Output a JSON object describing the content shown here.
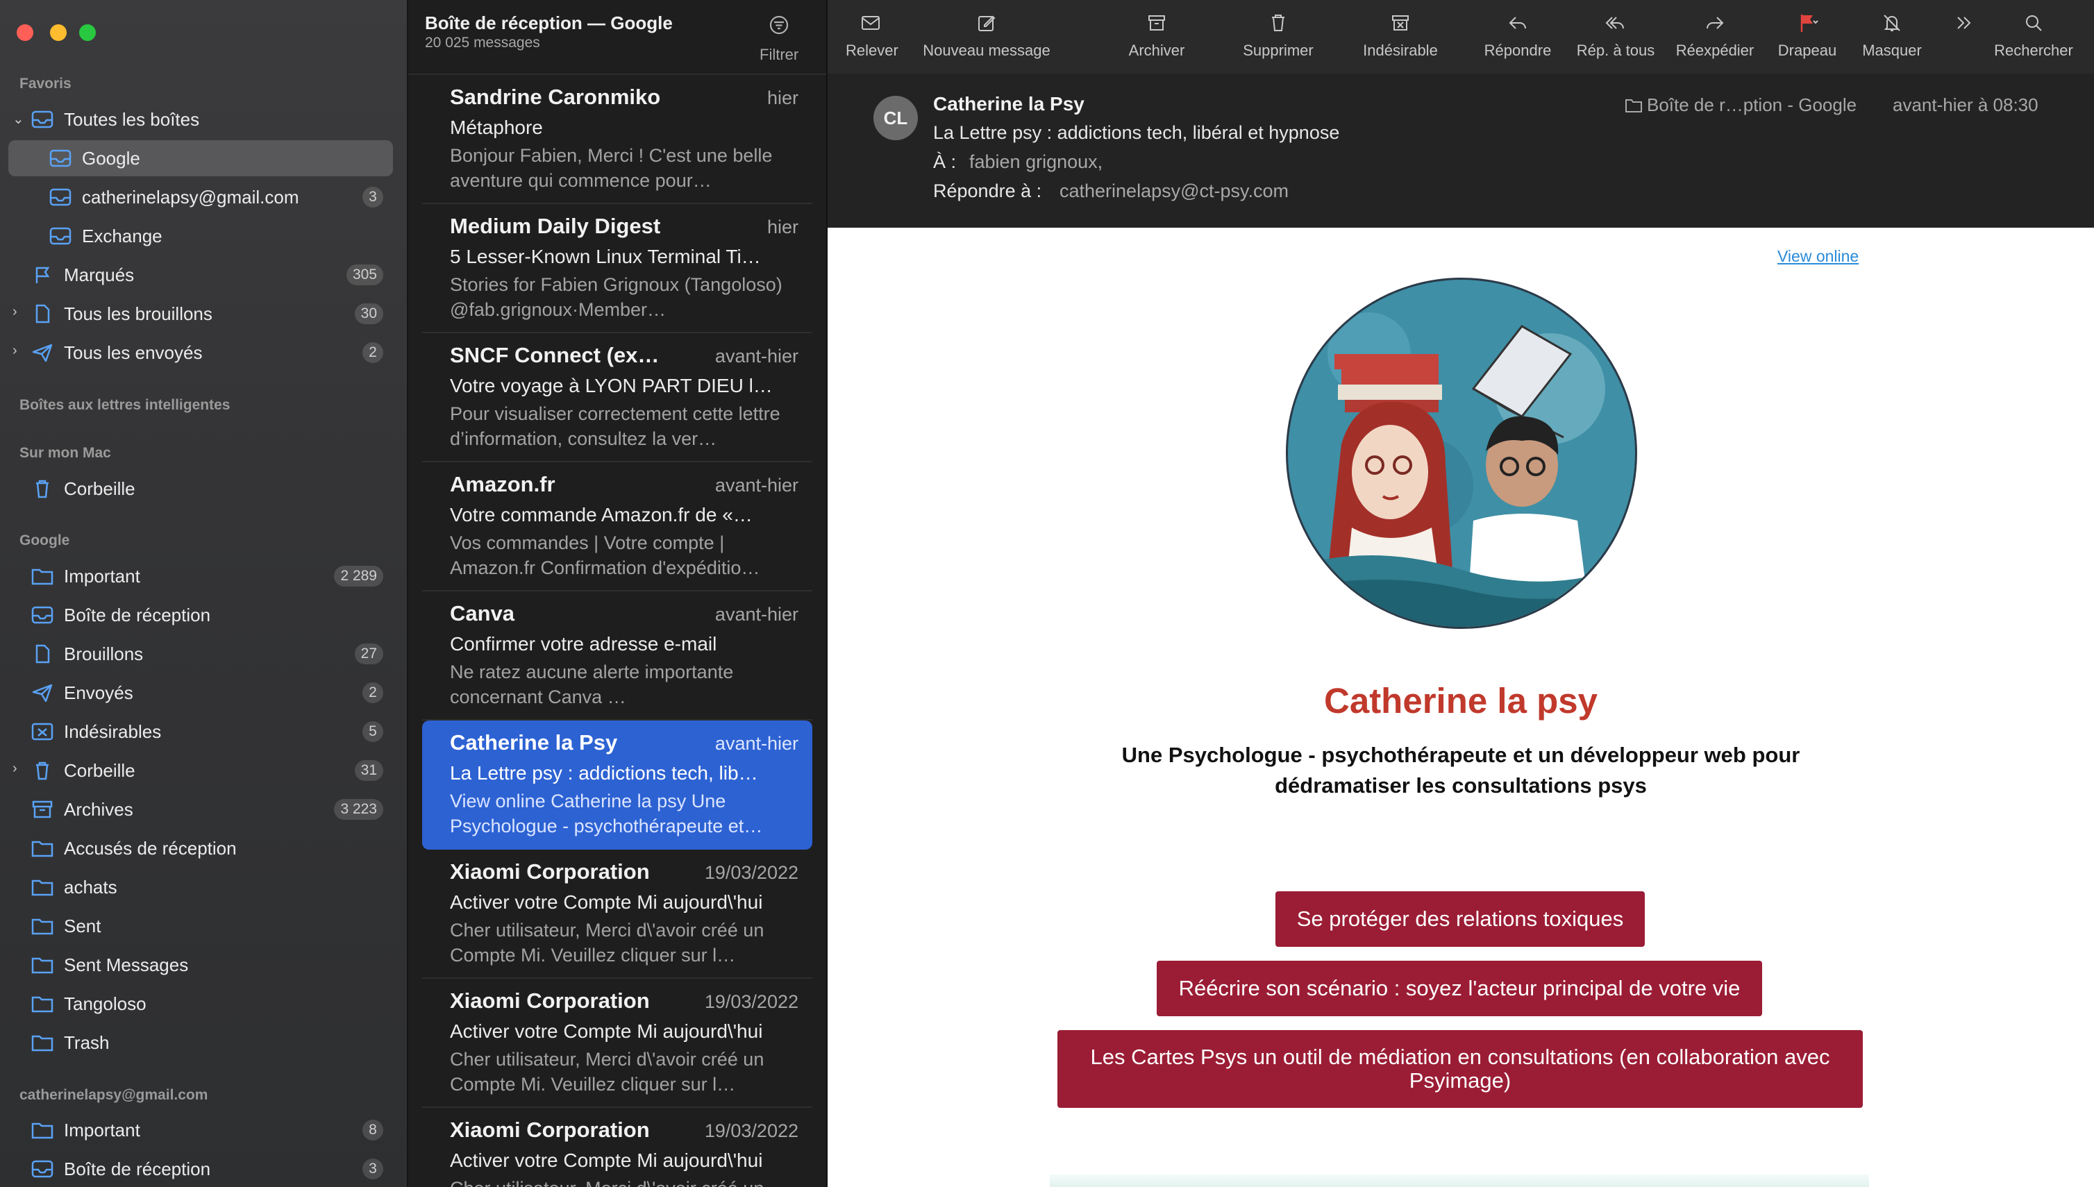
{
  "sidebar": {
    "sections": {
      "favoris": "Favoris",
      "smart": "Boîtes aux lettres intelligentes",
      "mac": "Sur mon Mac",
      "google": "Google",
      "catherine": "catherinelapsy@gmail.com"
    },
    "favoris": [
      {
        "label": "Toutes les boîtes",
        "badge": ""
      },
      {
        "label": "Google",
        "badge": ""
      },
      {
        "label": "catherinelapsy@gmail.com",
        "badge": "3"
      },
      {
        "label": "Exchange",
        "badge": ""
      },
      {
        "label": "Marqués",
        "badge": "305"
      },
      {
        "label": "Tous les brouillons",
        "badge": "30"
      },
      {
        "label": "Tous les envoyés",
        "badge": "2"
      }
    ],
    "mac": [
      {
        "label": "Corbeille",
        "badge": ""
      }
    ],
    "google": [
      {
        "label": "Important",
        "badge": "2 289"
      },
      {
        "label": "Boîte de réception",
        "badge": ""
      },
      {
        "label": "Brouillons",
        "badge": "27"
      },
      {
        "label": "Envoyés",
        "badge": "2"
      },
      {
        "label": "Indésirables",
        "badge": "5"
      },
      {
        "label": "Corbeille",
        "badge": "31"
      },
      {
        "label": "Archives",
        "badge": "3 223"
      },
      {
        "label": "Accusés de réception",
        "badge": ""
      },
      {
        "label": "achats",
        "badge": ""
      },
      {
        "label": "Sent",
        "badge": ""
      },
      {
        "label": "Sent Messages",
        "badge": ""
      },
      {
        "label": "Tangoloso",
        "badge": ""
      },
      {
        "label": "Trash",
        "badge": ""
      }
    ],
    "catherine": [
      {
        "label": "Important",
        "badge": "8"
      },
      {
        "label": "Boîte de réception",
        "badge": "3"
      }
    ]
  },
  "list": {
    "title": "Boîte de réception — Google",
    "count": "20 025 messages",
    "filter_label": "Filtrer",
    "messages": [
      {
        "sender": "Sandrine Caronmiko",
        "date": "hier",
        "subject": "Métaphore",
        "preview": "Bonjour Fabien, Merci !  C'est une belle aventure qui commence pour…"
      },
      {
        "sender": "Medium Daily Digest",
        "date": "hier",
        "subject": "5 Lesser-Known Linux Terminal Ti…",
        "preview": "Stories for Fabien Grignoux (Tangoloso) @fab.grignoux·Member…"
      },
      {
        "sender": "SNCF Connect (ex…",
        "date": "avant-hier",
        "subject": "Votre voyage à LYON PART DIEU l…",
        "preview": "Pour visualiser correctement cette lettre d’information, consultez la ver…"
      },
      {
        "sender": "Amazon.fr",
        "date": "avant-hier",
        "subject": "Votre commande Amazon.fr de «…",
        "preview": "Vos commandes | Votre compte |  Amazon.fr Confirmation d'expéditio…"
      },
      {
        "sender": "Canva",
        "date": "avant-hier",
        "subject": "Confirmer votre adresse e-mail",
        "preview": "Ne ratez aucune alerte importante concernant Canva                …"
      },
      {
        "sender": "Catherine la Psy",
        "date": "avant-hier",
        "subject": "La Lettre psy : addictions tech, lib…",
        "preview": "View online Catherine la psy Une Psychologue - psychothérapeute et…"
      },
      {
        "sender": "Xiaomi Corporation",
        "date": "19/03/2022",
        "subject": "Activer votre Compte Mi aujourd\\'hui",
        "preview": "Cher utilisateur, Merci d\\'avoir créé un Compte Mi. Veuillez cliquer sur l…"
      },
      {
        "sender": "Xiaomi Corporation",
        "date": "19/03/2022",
        "subject": "Activer votre Compte Mi aujourd\\'hui",
        "preview": "Cher utilisateur, Merci d\\'avoir créé un Compte Mi. Veuillez cliquer sur l…"
      },
      {
        "sender": "Xiaomi Corporation",
        "date": "19/03/2022",
        "subject": "Activer votre Compte Mi aujourd\\'hui",
        "preview": "Cher utilisateur, Merci d\\'avoir créé un Compte Mi. Veuillez cliquer sur l…"
      }
    ]
  },
  "toolbar": {
    "relever": "Relever",
    "nouveau": "Nouveau message",
    "archiver": "Archiver",
    "supprimer": "Supprimer",
    "indesirable": "Indésirable",
    "repondre": "Répondre",
    "rep_tous": "Rép. à tous",
    "reexpedier": "Réexpédier",
    "drapeau": "Drapeau",
    "masquer": "Masquer",
    "rechercher": "Rechercher"
  },
  "header": {
    "avatar": "CL",
    "sender": "Catherine la Psy",
    "subject": "La Lettre psy : addictions tech, libéral et hypnose",
    "to_label": "À :",
    "to": "fabien grignoux,",
    "reply_label": "Répondre à :",
    "reply_to": "catherinelapsy@ct-psy.com",
    "folder": "Boîte de r…ption - Google",
    "date": "avant-hier à 08:30"
  },
  "body": {
    "view_online": "View online",
    "brand_title": "Catherine la psy",
    "tagline": "Une Psychologue - psychothérapeute et un développeur web pour dédramatiser les consultations psys",
    "cta1": "Se protéger des relations toxiques",
    "cta2": "Réécrire son scénario : soyez l'acteur principal de votre vie",
    "cta3": "Les Cartes Psys un outil de médiation en consultations (en collaboration avec Psyimage)"
  },
  "colors": {
    "accent_blue": "#2d62d3",
    "brand_red": "#c0392b",
    "cta_bg": "#9b1d35",
    "flag_red": "#e0443e"
  },
  "icons": {
    "inbox": "inbox-icon",
    "folder": "folder-icon",
    "flag": "flag-icon",
    "draft": "draft-icon",
    "sent": "paper-plane-icon",
    "trash": "trash-icon",
    "junk": "junk-icon",
    "archive": "archive-icon"
  }
}
